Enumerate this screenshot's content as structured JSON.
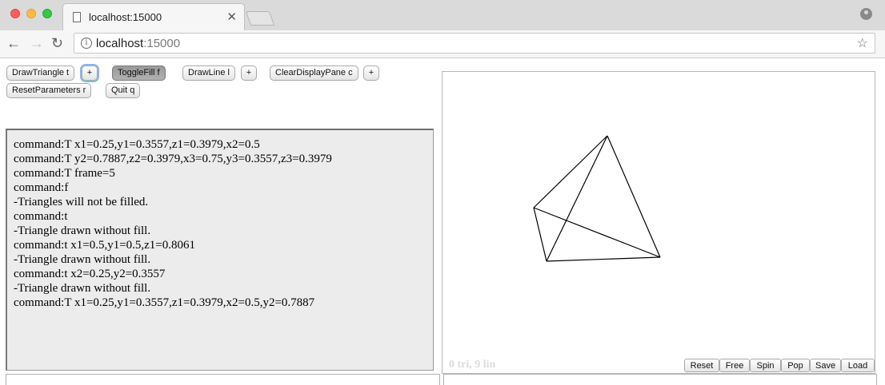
{
  "browser": {
    "tab_title": "localhost:15000",
    "url_host": "localhost",
    "url_port": ":15000"
  },
  "buttons": {
    "draw_triangle": "DrawTriangle t",
    "toggle_fill": "ToggleFill f",
    "draw_line": "DrawLine l",
    "clear_display": "ClearDisplayPane c",
    "reset_parameters": "ResetParameters r",
    "quit": "Quit q",
    "plus": "+"
  },
  "log": {
    "lines": [
      "command:T x1=0.25,y1=0.3557,z1=0.3979,x2=0.5",
      "command:T y2=0.7887,z2=0.3979,x3=0.75,y3=0.3557,z3=0.3979",
      "command:T frame=5",
      "command:f",
      "-Triangles will not be filled.",
      "command:t",
      "-Triangle drawn without fill.",
      "command:t x1=0.5,y1=0.5,z1=0.8061",
      "-Triangle drawn without fill.",
      "command:t x2=0.25,y2=0.3557",
      "-Triangle drawn without fill.",
      "command:T x1=0.25,y1=0.3557,z1=0.3979,x2=0.5,y2=0.7887"
    ]
  },
  "canvas": {
    "stats": "0 tri, 9 lin",
    "buttons": [
      "Reset",
      "Free",
      "Spin",
      "Pop",
      "Save",
      "Load"
    ],
    "stroke_color": "#000000"
  }
}
